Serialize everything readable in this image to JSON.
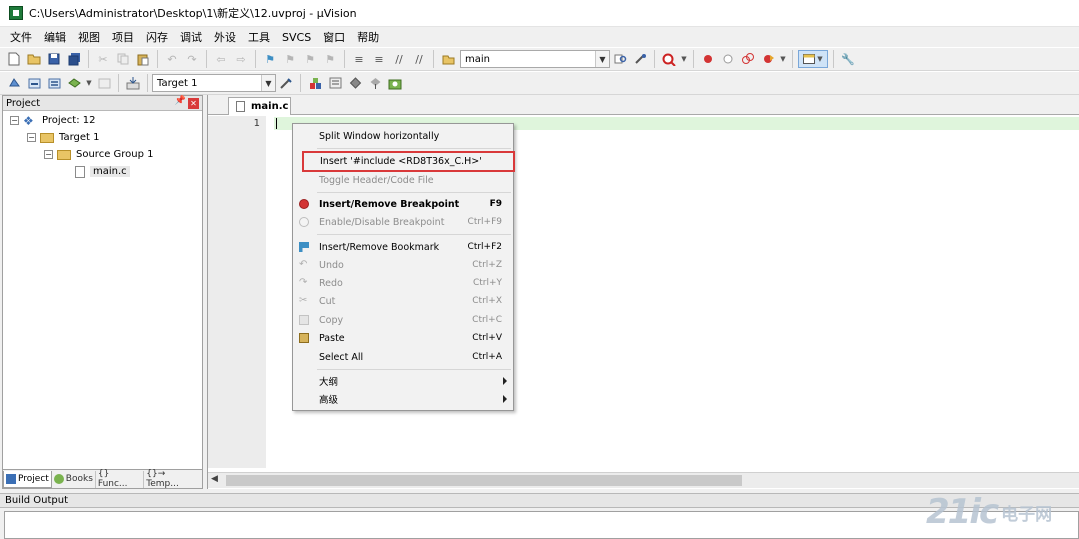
{
  "window": {
    "title": "C:\\Users\\Administrator\\Desktop\\1\\新定义\\12.uvproj - µVision"
  },
  "menubar": {
    "items": [
      "文件",
      "编辑",
      "视图",
      "项目",
      "闪存",
      "调试",
      "外设",
      "工具",
      "SVCS",
      "窗口",
      "帮助"
    ]
  },
  "toolbar": {
    "find_combo_value": "main",
    "target_combo_value": "Target 1"
  },
  "project_panel": {
    "title": "Project",
    "tree": [
      {
        "label": "Project: 12",
        "icon": "project-icon"
      },
      {
        "label": "Target 1",
        "icon": "target-folder-icon"
      },
      {
        "label": "Source Group 1",
        "icon": "folder-icon"
      },
      {
        "label": "main.c",
        "icon": "file-icon"
      }
    ],
    "tabs": [
      {
        "label": "Project",
        "icon": "project-tab-icon"
      },
      {
        "label": "Books",
        "icon": "books-icon"
      },
      {
        "label": "{} Func...",
        "icon": "functions-icon"
      },
      {
        "label": "{}→ Temp...",
        "icon": "templates-icon"
      }
    ]
  },
  "editor": {
    "tab_label": "main.c",
    "line_numbers": [
      "1"
    ]
  },
  "context_menu": {
    "items": [
      {
        "label": "Split Window horizontally",
        "shortcut": "",
        "state": "enabled"
      },
      {
        "label": "Insert '#include <RD8T36x_C.H>'",
        "shortcut": "",
        "state": "highlighted"
      },
      {
        "label": "Toggle Header/Code File",
        "shortcut": "",
        "state": "disabled"
      },
      {
        "label": "Insert/Remove Breakpoint",
        "shortcut": "F9",
        "state": "bold",
        "icon": "breakpoint-icon"
      },
      {
        "label": "Enable/Disable Breakpoint",
        "shortcut": "Ctrl+F9",
        "state": "disabled",
        "icon": "breakpoint-disabled-icon"
      },
      {
        "label": "Insert/Remove Bookmark",
        "shortcut": "Ctrl+F2",
        "state": "enabled",
        "icon": "bookmark-icon"
      },
      {
        "label": "Undo",
        "shortcut": "Ctrl+Z",
        "state": "disabled",
        "icon": "undo-icon"
      },
      {
        "label": "Redo",
        "shortcut": "Ctrl+Y",
        "state": "disabled",
        "icon": "redo-icon"
      },
      {
        "label": "Cut",
        "shortcut": "Ctrl+X",
        "state": "disabled",
        "icon": "cut-icon"
      },
      {
        "label": "Copy",
        "shortcut": "Ctrl+C",
        "state": "disabled",
        "icon": "copy-icon"
      },
      {
        "label": "Paste",
        "shortcut": "Ctrl+V",
        "state": "enabled",
        "icon": "paste-icon"
      },
      {
        "label": "Select All",
        "shortcut": "Ctrl+A",
        "state": "enabled"
      },
      {
        "label": "大纲",
        "shortcut": "",
        "state": "submenu"
      },
      {
        "label": "高级",
        "shortcut": "",
        "state": "submenu"
      }
    ]
  },
  "build_output": {
    "title": "Build Output"
  },
  "watermark": {
    "text_main": "21ic",
    "text_sub": "电子网"
  }
}
